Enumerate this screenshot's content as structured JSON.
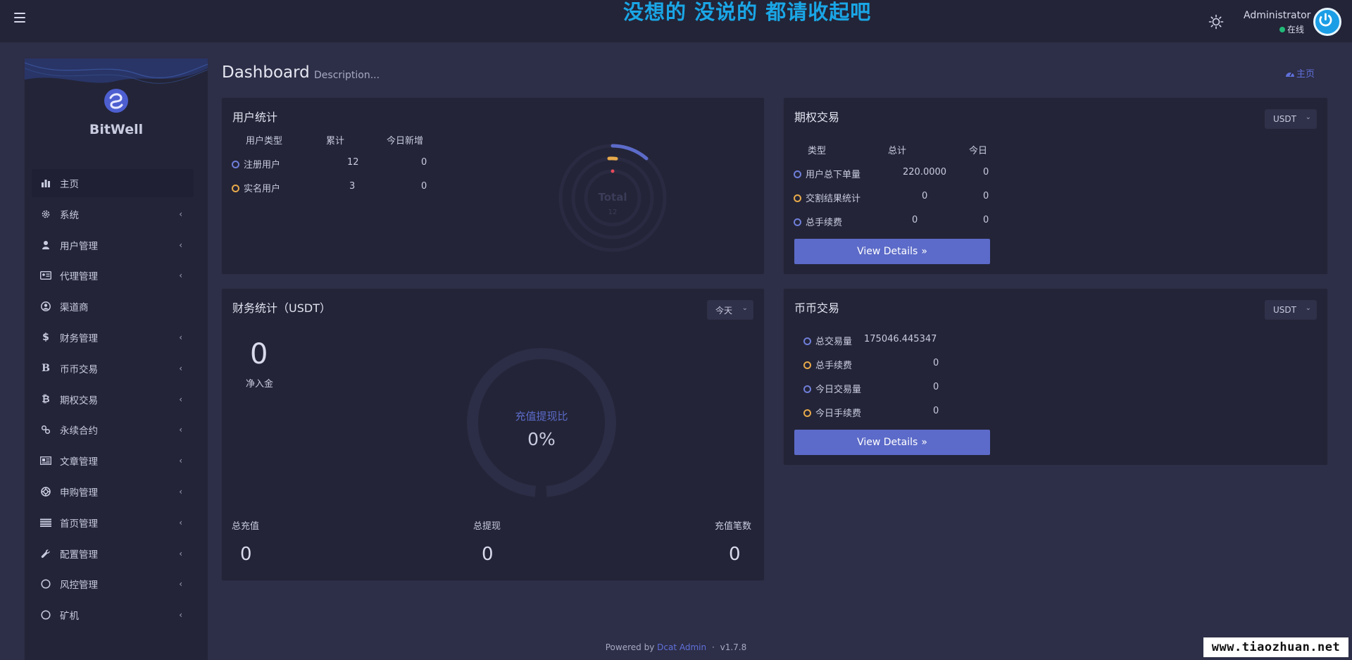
{
  "header": {
    "banner": "没想的 没说的 都请收起吧",
    "user_name": "Administrator",
    "user_status": "在线"
  },
  "sidebar": {
    "brand": "BitWell",
    "items": [
      {
        "label": "主页",
        "icon": "bar-chart-icon",
        "active": true
      },
      {
        "label": "系统",
        "icon": "gear-icon"
      },
      {
        "label": "用户管理",
        "icon": "user-icon"
      },
      {
        "label": "代理管理",
        "icon": "id-card-icon"
      },
      {
        "label": "渠道商",
        "icon": "user-circle-icon"
      },
      {
        "label": "财务管理",
        "icon": "dollar-icon"
      },
      {
        "label": "币币交易",
        "icon": "bold-b-icon"
      },
      {
        "label": "期权交易",
        "icon": "bitcoin-icon"
      },
      {
        "label": "永续合约",
        "icon": "link-icon"
      },
      {
        "label": "文章管理",
        "icon": "newspaper-icon"
      },
      {
        "label": "申购管理",
        "icon": "life-ring-icon"
      },
      {
        "label": "首页管理",
        "icon": "list-icon"
      },
      {
        "label": "配置管理",
        "icon": "wrench-icon"
      },
      {
        "label": "风控管理",
        "icon": "circle-icon"
      },
      {
        "label": "矿机",
        "icon": "circle-icon"
      }
    ]
  },
  "page": {
    "title": "Dashboard",
    "description": "Description...",
    "breadcrumb": "主页"
  },
  "user_stats": {
    "title": "用户统计",
    "headers": [
      "用户类型",
      "累计",
      "今日新增"
    ],
    "rows": [
      {
        "type": "注册用户",
        "total": "12",
        "today": "0"
      },
      {
        "type": "实名用户",
        "total": "3",
        "today": "0"
      }
    ],
    "chart_center_label": "Total",
    "chart_center_value": "12"
  },
  "options_trade": {
    "title": "期权交易",
    "select": "USDT",
    "headers": [
      "类型",
      "总计",
      "今日"
    ],
    "rows": [
      {
        "type": "用户总下单量",
        "total": "220.0000",
        "today": "0"
      },
      {
        "type": "交割结果统计",
        "total": "0",
        "today": "0"
      },
      {
        "type": "总手续费",
        "total": "0",
        "today": "0"
      }
    ],
    "button": "View Details"
  },
  "finance": {
    "title": "财务统计（USDT）",
    "select": "今天",
    "net_value": "0",
    "net_label": "净入金",
    "ratio_label": "充值提现比",
    "ratio_value": "0%",
    "ratio_fraction": 0,
    "stats": [
      {
        "label": "总充值",
        "value": "0"
      },
      {
        "label": "总提现",
        "value": "0"
      },
      {
        "label": "充值笔数",
        "value": "0"
      }
    ]
  },
  "coin_trade": {
    "title": "币币交易",
    "select": "USDT",
    "rows": [
      {
        "label": "总交易量",
        "value": "175046.445347"
      },
      {
        "label": "总手续费",
        "value": "0"
      },
      {
        "label": "今日交易量",
        "value": "0"
      },
      {
        "label": "今日手续费",
        "value": "0"
      }
    ],
    "button": "View Details"
  },
  "footer": {
    "powered": "Powered by",
    "link": "Dcat Admin",
    "separator": "·",
    "version": "v1.7.8"
  },
  "watermark": "www.tiaozhuan.net",
  "colors": {
    "accent": "#5c6bc9",
    "banner": "#1aa6e6",
    "online": "#21b978",
    "orange": "#e7a94b"
  }
}
